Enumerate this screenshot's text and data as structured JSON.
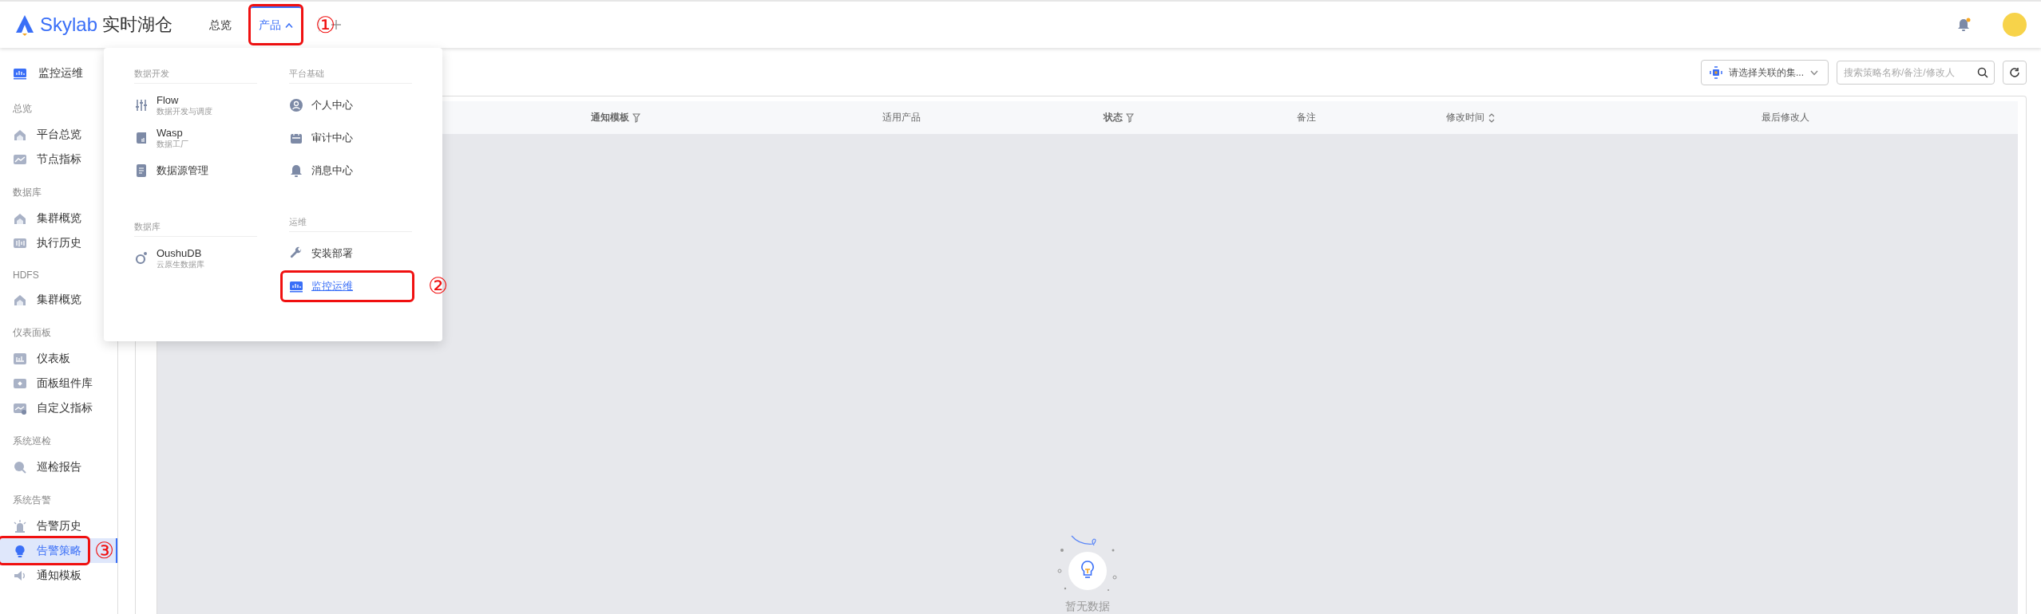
{
  "header": {
    "logo_brand": "Skylab",
    "logo_product": "实时湖仓",
    "nav": [
      {
        "label": "总览",
        "selected": false,
        "expanded": false
      },
      {
        "label": "产品",
        "selected": true,
        "expanded": true,
        "annotation": "①"
      }
    ]
  },
  "sidebar": {
    "title": "监控运维",
    "groups": [
      {
        "label": "总览",
        "items": [
          {
            "label": "平台总览",
            "selected": false
          },
          {
            "label": "节点指标",
            "selected": false
          }
        ]
      },
      {
        "label": "数据库",
        "items": [
          {
            "label": "集群概览",
            "selected": false
          },
          {
            "label": "执行历史",
            "selected": false
          }
        ]
      },
      {
        "label": "HDFS",
        "items": [
          {
            "label": "集群概览",
            "selected": false
          }
        ]
      },
      {
        "label": "仪表面板",
        "items": [
          {
            "label": "仪表板",
            "selected": false
          },
          {
            "label": "面板组件库",
            "selected": false
          },
          {
            "label": "自定义指标",
            "selected": false
          }
        ]
      },
      {
        "label": "系统巡检",
        "items": [
          {
            "label": "巡检报告",
            "selected": false
          }
        ]
      },
      {
        "label": "系统告警",
        "items": [
          {
            "label": "告警历史",
            "selected": false
          },
          {
            "label": "告警策略",
            "selected": true,
            "annotation": "③"
          },
          {
            "label": "通知模板",
            "selected": false
          }
        ]
      }
    ]
  },
  "product_menu": {
    "columns": [
      [
        {
          "title": "数据开发",
          "items": [
            {
              "label": "Flow",
              "subtitle": "数据开发与调度",
              "selected": false
            },
            {
              "label": "Wasp",
              "subtitle": "数据工厂",
              "selected": false
            },
            {
              "label": "数据源管理",
              "selected": false
            }
          ]
        },
        {
          "title": "数据库",
          "items": [
            {
              "label": "OushuDB",
              "subtitle": "云原生数据库",
              "selected": false
            }
          ]
        }
      ],
      [
        {
          "title": "平台基础",
          "items": [
            {
              "label": "个人中心",
              "selected": false
            },
            {
              "label": "审计中心",
              "selected": false
            },
            {
              "label": "消息中心",
              "selected": false
            }
          ]
        },
        {
          "title": "运维",
          "items": [
            {
              "label": "安装部署",
              "selected": false
            },
            {
              "label": "监控运维",
              "selected": true,
              "annotation": "②"
            }
          ]
        }
      ]
    ]
  },
  "toolbar": {
    "cluster_select": {
      "placeholder": "请选择关联的集..."
    },
    "search": {
      "placeholder": "搜索策略名称/备注/修改人"
    }
  },
  "table": {
    "columns": [
      {
        "label": "通知模板",
        "kind": "filter"
      },
      {
        "label": "适用产品",
        "kind": "plain"
      },
      {
        "label": "状态",
        "kind": "filter"
      },
      {
        "label": "备注",
        "kind": "plain"
      },
      {
        "label": "修改时间",
        "kind": "sort"
      },
      {
        "label": "最后修改人",
        "kind": "plain"
      }
    ],
    "empty_text": "暂无数据"
  }
}
